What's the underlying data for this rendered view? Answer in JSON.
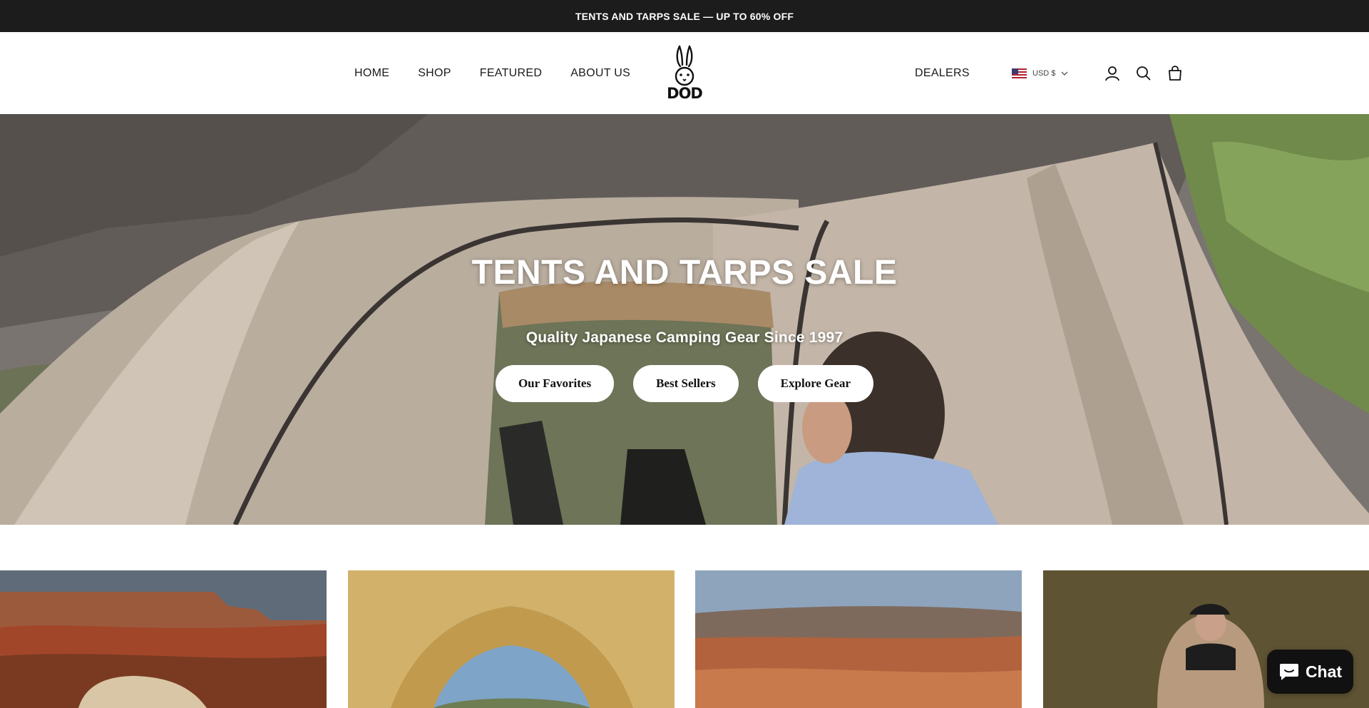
{
  "announcement": {
    "text": "TENTS AND TARPS SALE — UP TO 60% OFF"
  },
  "header": {
    "nav_left": [
      {
        "label": "HOME"
      },
      {
        "label": "SHOP"
      },
      {
        "label": "FEATURED"
      },
      {
        "label": "ABOUT US"
      }
    ],
    "logo_text": "DOD",
    "nav_right": {
      "label": "DEALERS"
    },
    "currency": {
      "label": "USD $",
      "flag_icon": "us-flag-icon"
    },
    "icons": [
      "account-icon",
      "search-icon",
      "cart-icon"
    ]
  },
  "hero": {
    "title": "TENTS AND TARPS SALE",
    "subtitle": "Quality Japanese Camping Gear Since 1997",
    "buttons": [
      {
        "label": "Our Favorites"
      },
      {
        "label": "Best Sellers"
      },
      {
        "label": "Explore Gear"
      }
    ]
  },
  "chat": {
    "label": "Chat",
    "icon": "chat-bubble-icon"
  },
  "colors": {
    "announcement_bg": "#1c1c1c",
    "chat_bg": "#111111",
    "button_bg": "#ffffff"
  }
}
